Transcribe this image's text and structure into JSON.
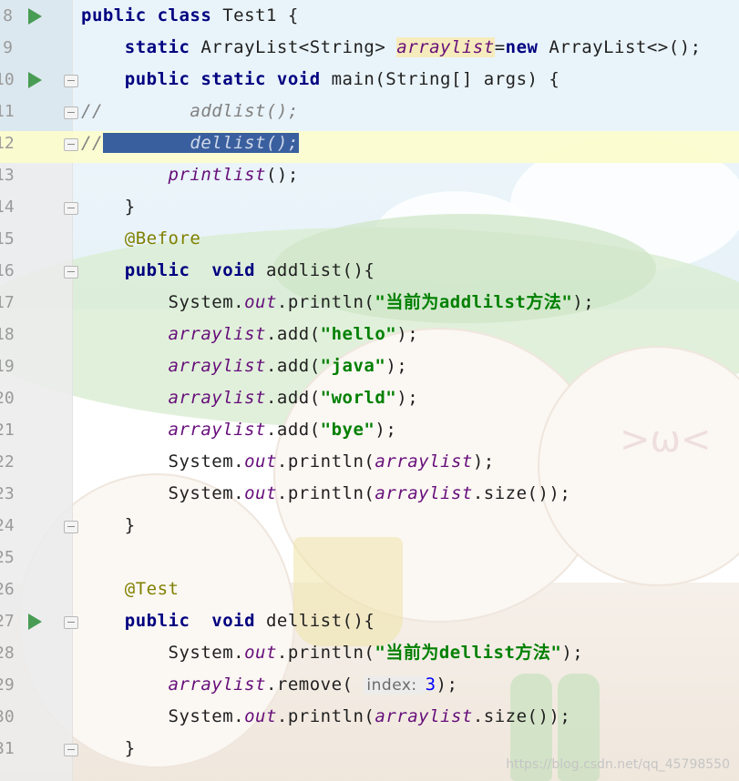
{
  "editor": {
    "lines": [
      {
        "num": "8",
        "run": true,
        "tokens": [
          [
            "kw",
            "public class "
          ],
          [
            "plain",
            "Test1 {"
          ]
        ]
      },
      {
        "num": "9",
        "run": false,
        "tokens": [
          [
            "plain",
            "    "
          ],
          [
            "kw",
            "static "
          ],
          [
            "plain",
            "ArrayList<String> "
          ],
          [
            "field warn",
            "arraylist"
          ],
          [
            "plain",
            "="
          ],
          [
            "kw",
            "new "
          ],
          [
            "plain",
            "ArrayList<>();"
          ]
        ]
      },
      {
        "num": "10",
        "run": true,
        "tokens": [
          [
            "plain",
            "    "
          ],
          [
            "kw",
            "public static void "
          ],
          [
            "plain",
            "main(String[] args) {"
          ]
        ]
      },
      {
        "num": "11",
        "run": false,
        "tokens": [
          [
            "cmt",
            "//        addlist();"
          ]
        ]
      },
      {
        "num": "12",
        "run": false,
        "tokens": [
          [
            "cmt",
            "//"
          ],
          [
            "sel",
            "      "
          ],
          [
            "sel cmt",
            "  dellist();"
          ]
        ]
      },
      {
        "num": "13",
        "run": false,
        "tokens": [
          [
            "plain",
            "        "
          ],
          [
            "field",
            "printlist"
          ],
          [
            "plain",
            "();"
          ]
        ]
      },
      {
        "num": "14",
        "run": false,
        "tokens": [
          [
            "plain",
            "    }"
          ]
        ]
      },
      {
        "num": "15",
        "run": false,
        "tokens": [
          [
            "plain",
            "    "
          ],
          [
            "ann",
            "@Before"
          ]
        ]
      },
      {
        "num": "16",
        "run": false,
        "tokens": [
          [
            "plain",
            "    "
          ],
          [
            "kw",
            "public  void "
          ],
          [
            "plain",
            "addlist(){"
          ]
        ]
      },
      {
        "num": "17",
        "run": false,
        "tokens": [
          [
            "plain",
            "        System."
          ],
          [
            "field",
            "out"
          ],
          [
            "plain",
            ".println("
          ],
          [
            "str",
            "\"当前为addlilst方法\""
          ],
          [
            "plain",
            ");"
          ]
        ]
      },
      {
        "num": "18",
        "run": false,
        "tokens": [
          [
            "plain",
            "        "
          ],
          [
            "field",
            "arraylist"
          ],
          [
            "plain",
            ".add("
          ],
          [
            "str",
            "\"hello\""
          ],
          [
            "plain",
            ");"
          ]
        ]
      },
      {
        "num": "19",
        "run": false,
        "tokens": [
          [
            "plain",
            "        "
          ],
          [
            "field",
            "arraylist"
          ],
          [
            "plain",
            ".add("
          ],
          [
            "str",
            "\"java\""
          ],
          [
            "plain",
            ");"
          ]
        ]
      },
      {
        "num": "20",
        "run": false,
        "tokens": [
          [
            "plain",
            "        "
          ],
          [
            "field",
            "arraylist"
          ],
          [
            "plain",
            ".add("
          ],
          [
            "str",
            "\"world\""
          ],
          [
            "plain",
            ");"
          ]
        ]
      },
      {
        "num": "21",
        "run": false,
        "tokens": [
          [
            "plain",
            "        "
          ],
          [
            "field",
            "arraylist"
          ],
          [
            "plain",
            ".add("
          ],
          [
            "str",
            "\"bye\""
          ],
          [
            "plain",
            ");"
          ]
        ]
      },
      {
        "num": "22",
        "run": false,
        "tokens": [
          [
            "plain",
            "        System."
          ],
          [
            "field",
            "out"
          ],
          [
            "plain",
            ".println("
          ],
          [
            "field",
            "arraylist"
          ],
          [
            "plain",
            ");"
          ]
        ]
      },
      {
        "num": "23",
        "run": false,
        "tokens": [
          [
            "plain",
            "        System."
          ],
          [
            "field",
            "out"
          ],
          [
            "plain",
            ".println("
          ],
          [
            "field",
            "arraylist"
          ],
          [
            "plain",
            ".size());"
          ]
        ]
      },
      {
        "num": "24",
        "run": false,
        "tokens": [
          [
            "plain",
            "    }"
          ]
        ]
      },
      {
        "num": "25",
        "run": false,
        "tokens": []
      },
      {
        "num": "26",
        "run": false,
        "tokens": [
          [
            "plain",
            "    "
          ],
          [
            "ann",
            "@Test"
          ]
        ]
      },
      {
        "num": "27",
        "run": true,
        "tokens": [
          [
            "plain",
            "    "
          ],
          [
            "kw",
            "public  void "
          ],
          [
            "plain",
            "dellist(){"
          ]
        ]
      },
      {
        "num": "28",
        "run": false,
        "tokens": [
          [
            "plain",
            "        System."
          ],
          [
            "field",
            "out"
          ],
          [
            "plain",
            ".println("
          ],
          [
            "str",
            "\"当前为dellist方法\""
          ],
          [
            "plain",
            ");"
          ]
        ]
      },
      {
        "num": "29",
        "run": false,
        "tokens": [
          [
            "plain",
            "        "
          ],
          [
            "field",
            "arraylist"
          ],
          [
            "plain",
            ".remove( "
          ],
          [
            "hint",
            "index: "
          ],
          [
            "num",
            "3"
          ],
          [
            "plain",
            ");"
          ]
        ]
      },
      {
        "num": "30",
        "run": false,
        "tokens": [
          [
            "plain",
            "        System."
          ],
          [
            "field",
            "out"
          ],
          [
            "plain",
            ".println("
          ],
          [
            "field",
            "arraylist"
          ],
          [
            "plain",
            ".size());"
          ]
        ]
      },
      {
        "num": "31",
        "run": false,
        "tokens": [
          [
            "plain",
            "    }"
          ]
        ]
      }
    ]
  },
  "watermark": "https://blog.csdn.net/qq_45798550"
}
